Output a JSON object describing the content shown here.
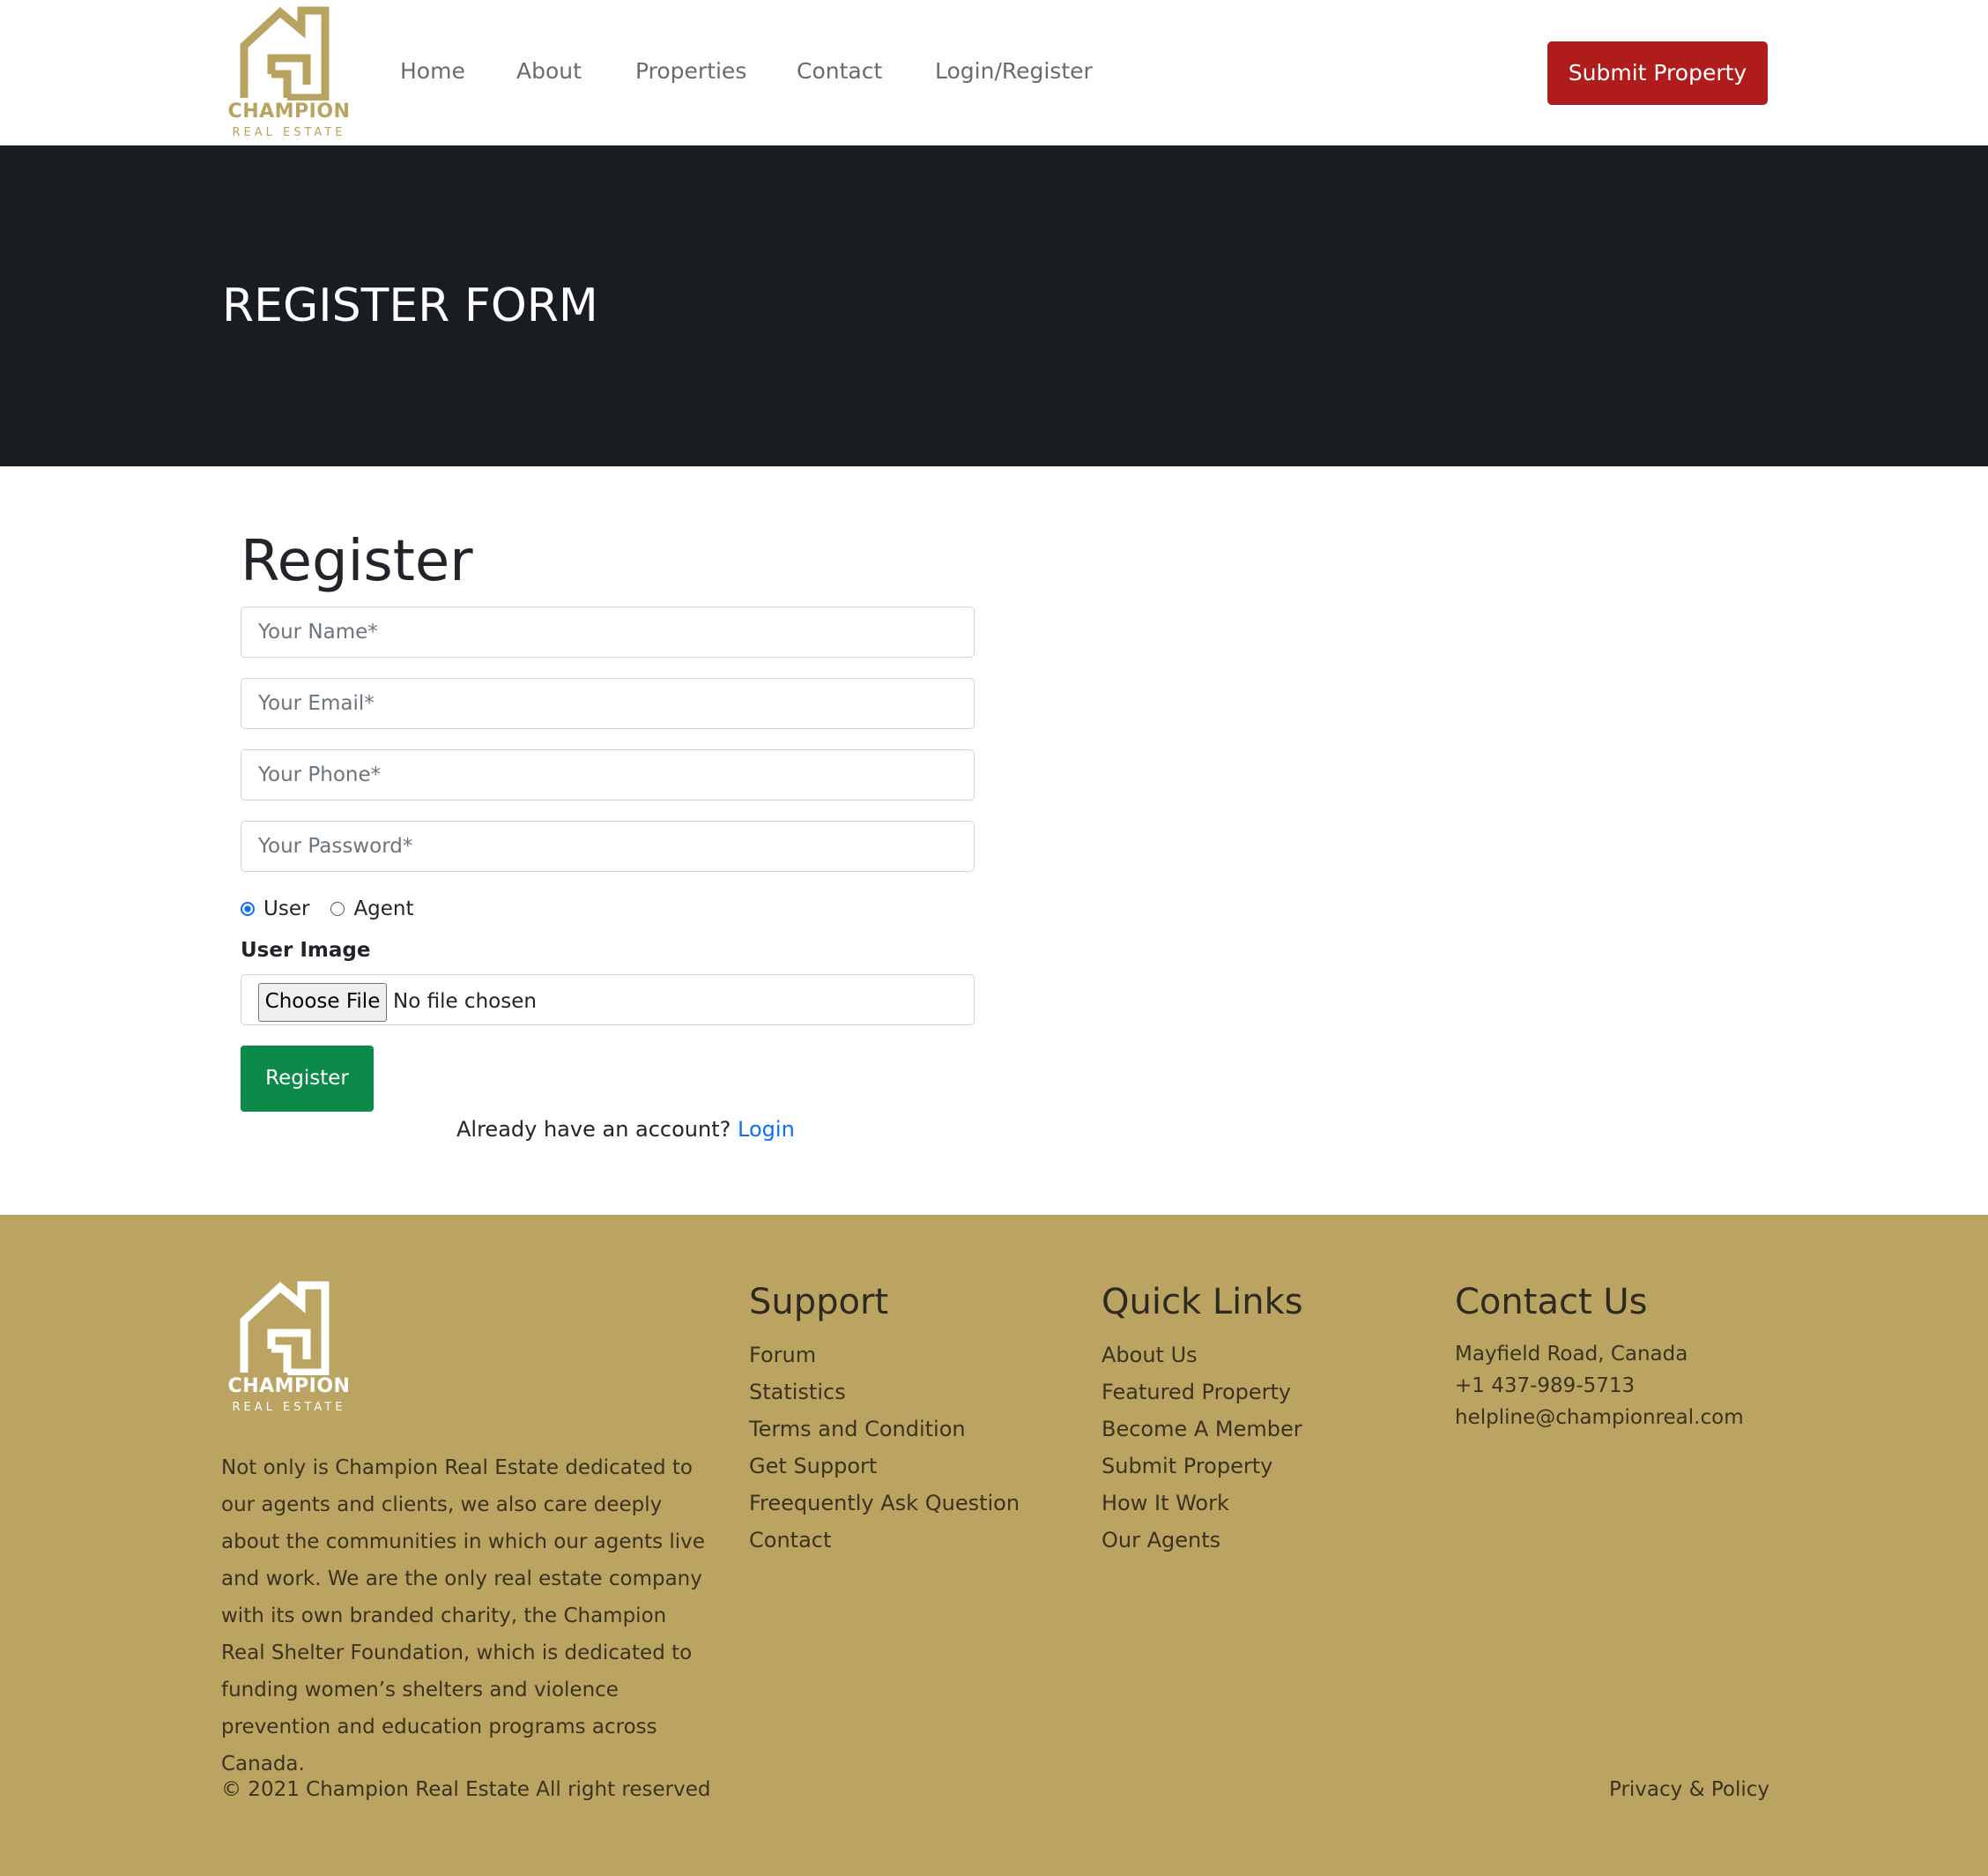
{
  "brand": {
    "line1": "CHAMPION",
    "line2": "REAL ESTATE"
  },
  "nav": {
    "items": [
      {
        "label": "Home"
      },
      {
        "label": "About"
      },
      {
        "label": "Properties"
      },
      {
        "label": "Contact"
      },
      {
        "label": "Login/Register"
      }
    ],
    "submit_label": "Submit Property"
  },
  "banner": {
    "title": "REGISTER FORM"
  },
  "form": {
    "heading": "Register",
    "name_placeholder": "Your Name*",
    "email_placeholder": "Your Email*",
    "phone_placeholder": "Your Phone*",
    "password_placeholder": "Your Password*",
    "role_options": [
      "User",
      "Agent"
    ],
    "selected_role": "User",
    "image_label": "User Image",
    "choose_file_label": "Choose File",
    "no_file_text": "No file chosen",
    "submit_label": "Register",
    "already_text": "Already have an account?",
    "login_link": "Login"
  },
  "footer": {
    "about": "Not only is Champion Real Estate dedicated to our agents and clients, we also care deeply about the communities in which our agents live and work. We are the only real estate company with its own branded charity, the Champion Real Shelter Foundation, which is dedicated to funding women’s shelters and violence prevention and education programs across Canada.",
    "support": {
      "heading": "Support",
      "links": [
        "Forum",
        "Statistics",
        "Terms and Condition",
        "Get Support",
        "Freequently Ask Question",
        "Contact"
      ]
    },
    "quick_links": {
      "heading": "Quick Links",
      "links": [
        "About Us",
        "Featured Property",
        "Become A Member",
        "Submit Property",
        "How It Work",
        "Our Agents"
      ]
    },
    "contact": {
      "heading": "Contact Us",
      "address": "Mayfield Road, Canada",
      "phone": "+1 437-989-5713",
      "email": "helpline@championreal.com"
    },
    "copyright": "© 2021 Champion Real Estate All right reserved",
    "privacy": "Privacy & Policy"
  },
  "colors": {
    "brand_gold": "#bba462",
    "banner_dark": "#191c21",
    "submit_red": "#b01c1c",
    "register_green": "#0b8a4a",
    "link_blue": "#0d6efd"
  },
  "icons": {
    "logo": "house-logo-icon",
    "radio_checked": "radio-checked-icon"
  }
}
